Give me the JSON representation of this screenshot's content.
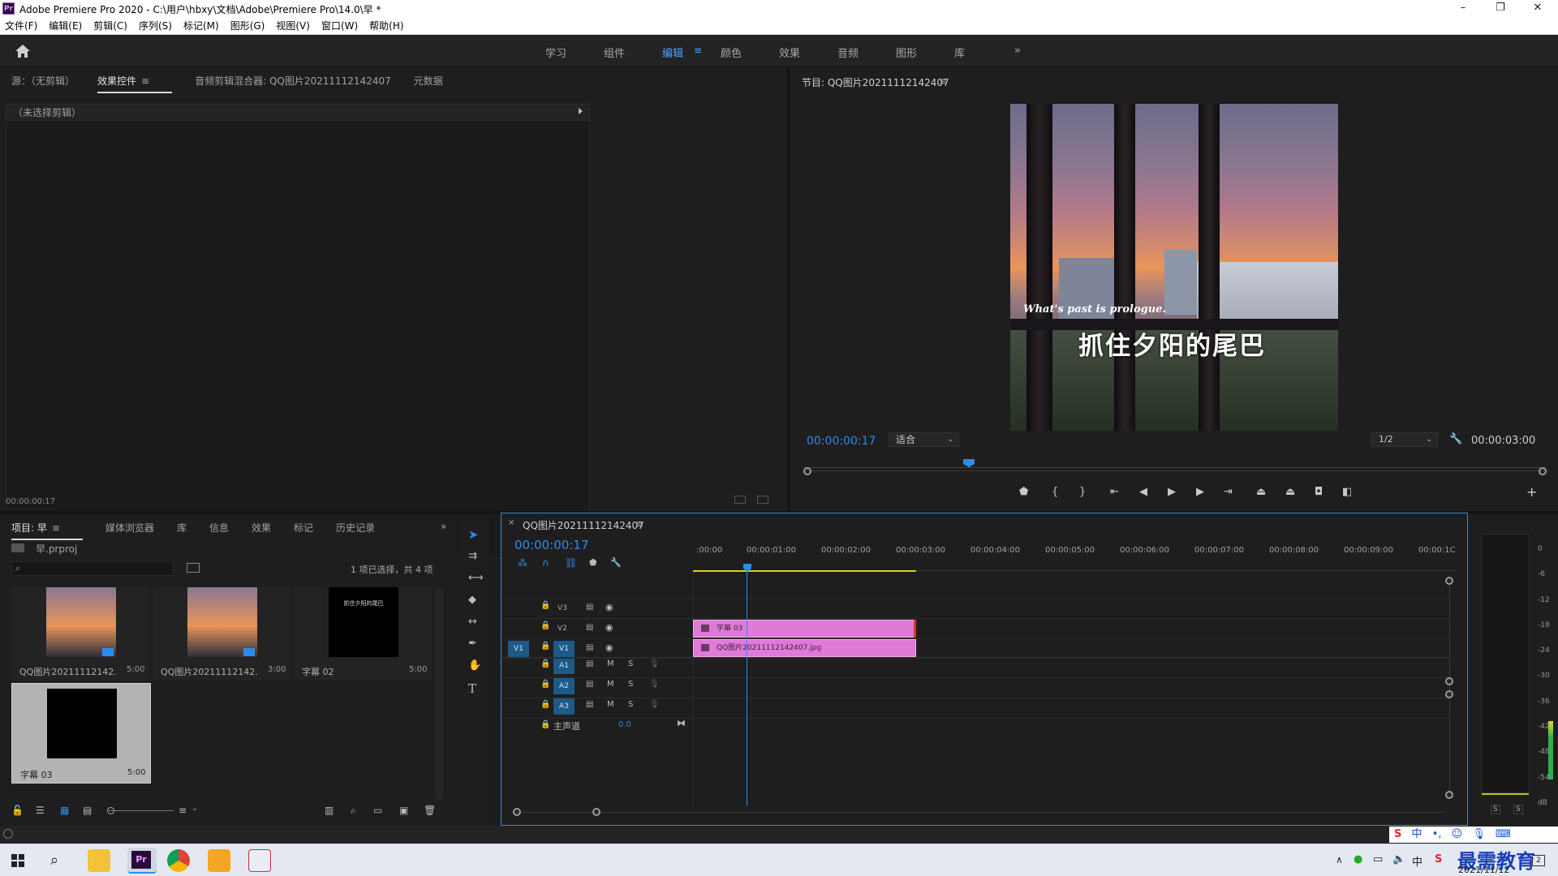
{
  "window": {
    "title": "Adobe Premiere Pro 2020 - C:\\用户\\hbxy\\文档\\Adobe\\Premiere Pro\\14.0\\早 *",
    "logo": "Pr",
    "minimize": "–",
    "restore": "❐",
    "close": "✕"
  },
  "menu": [
    "文件(F)",
    "编辑(E)",
    "剪辑(C)",
    "序列(S)",
    "标记(M)",
    "图形(G)",
    "视图(V)",
    "窗口(W)",
    "帮助(H)"
  ],
  "workspaces": [
    {
      "label": "学习",
      "active": false
    },
    {
      "label": "组件",
      "active": false
    },
    {
      "label": "编辑",
      "active": true
    },
    {
      "label": "颜色",
      "active": false
    },
    {
      "label": "效果",
      "active": false
    },
    {
      "label": "音频",
      "active": false
    },
    {
      "label": "图形",
      "active": false
    },
    {
      "label": "库",
      "active": false
    }
  ],
  "workspace_more": "»",
  "source_panel": {
    "tabs": [
      "源：（无剪辑）",
      "效果控件",
      "音频剪辑混合器: QQ图片20211112142407",
      "元数据"
    ],
    "active_tab": 1,
    "no_clip": "（未选择剪辑）",
    "timecode": "00:00:00:17"
  },
  "program_monitor": {
    "title": "节目: QQ图片20211112142407",
    "timecode": "00:00:00:17",
    "fit": "适合",
    "resolution": "1/2",
    "duration": "00:00:03:00",
    "caption_en": "What's past is prologue.",
    "caption_cn": "抓住夕阳的尾巴"
  },
  "project_panel": {
    "tabs": [
      "项目: 早",
      "媒体浏览器",
      "库",
      "信息",
      "效果",
      "标记",
      "历史记录"
    ],
    "file": "早.prproj",
    "selection": "1 项已选择，共 4 项",
    "items": [
      {
        "name": "QQ图片202111121​42...",
        "duration": "5:00",
        "kind": "image"
      },
      {
        "name": "QQ图片202111121​42...",
        "duration": "3:00",
        "kind": "image"
      },
      {
        "name": "字幕 02",
        "duration": "5:00",
        "kind": "title",
        "preview": "抓住夕阳的尾巴"
      },
      {
        "name": "字幕 03",
        "duration": "5:00",
        "kind": "black"
      }
    ]
  },
  "timeline": {
    "title": "QQ图片20211112142407",
    "timecode": "00:00:00:17",
    "ruler": [
      ":00:00",
      "00:00:01:00",
      "00:00:02:00",
      "00:00:03:00",
      "00:00:04:00",
      "00:00:05:00",
      "00:00:06:00",
      "00:00:07:00",
      "00:00:08:00",
      "00:00:09:00",
      "00:00:1C"
    ],
    "video_tracks": [
      "V3",
      "V2",
      "V1"
    ],
    "audio_tracks": [
      "A1",
      "A2",
      "A3"
    ],
    "source_patch_video": "V1",
    "master": "主声道",
    "master_value": "0.0",
    "mute": "M",
    "solo": "S",
    "clips": [
      {
        "track": "V2",
        "label": "字幕 03"
      },
      {
        "track": "V1",
        "label": "QQ图片20211112142407.jpg"
      }
    ]
  },
  "meter": {
    "scale": [
      "0",
      "-6",
      "-12",
      "-18",
      "-24",
      "-30",
      "-36",
      "-42",
      "-48",
      "-54",
      "dB"
    ],
    "solo_labels": [
      "S",
      "S"
    ]
  },
  "taskbar": {
    "ime": "中",
    "brand": "最需教育",
    "time": "2021/11/12",
    "notif": "2"
  },
  "colors": {
    "accent": "#2d8ceb",
    "clip": "#e07ad8",
    "selected_track": "#1e5a88"
  }
}
